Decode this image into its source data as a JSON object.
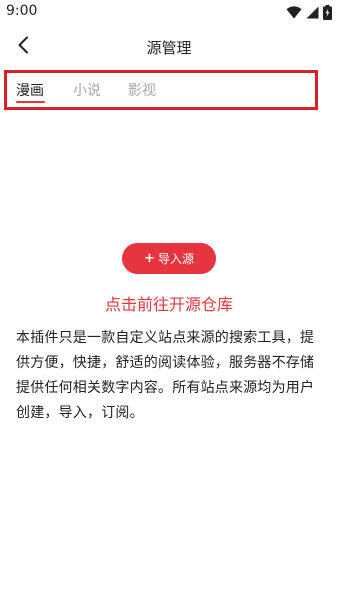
{
  "status_bar": {
    "time": "9:00",
    "icons": [
      "wifi-icon",
      "signal-icon",
      "battery-charging-icon"
    ]
  },
  "header": {
    "title": "源管理",
    "back_icon": "chevron-left-icon"
  },
  "tabs": [
    {
      "label": "漫画",
      "selected": true
    },
    {
      "label": "小说",
      "selected": false
    },
    {
      "label": "影视",
      "selected": false
    }
  ],
  "import_button": {
    "icon": "+",
    "label": "导入源"
  },
  "repo_link": "点击前往开源仓库",
  "description": "本插件只是一款自定义站点来源的搜索工具，提供方便，快捷，舒适的阅读体验，服务器不存储提供任何相关数字内容。所有站点来源均为用户创建，导入，订阅。",
  "colors": {
    "accent": "#e6353f",
    "highlight_border": "#d9202a",
    "inactive_tab": "#a6a6a6"
  }
}
